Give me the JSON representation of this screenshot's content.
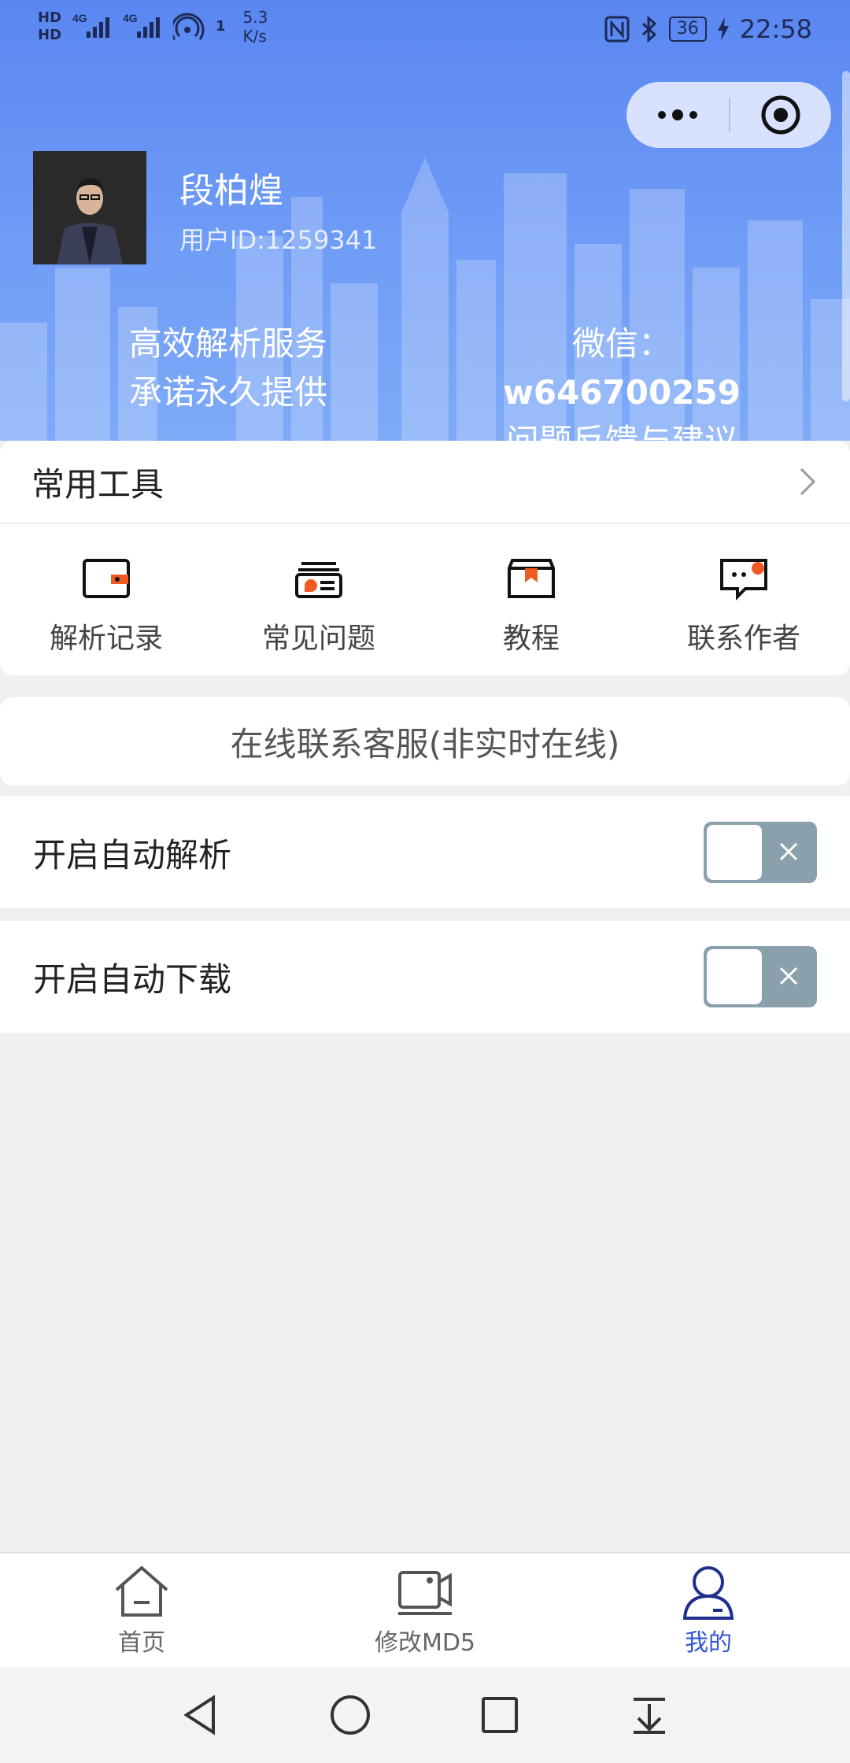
{
  "status_bar": {
    "hd1": "HD",
    "hd2": "HD",
    "net1": "4G",
    "net2": "4G",
    "wifi_count": "1",
    "speed": "5.3",
    "speed_unit": "K/s",
    "battery": "36",
    "time": "22:58"
  },
  "capsule": {
    "more_icon": "more-dots-icon",
    "close_icon": "target-close-icon"
  },
  "user": {
    "name": "段柏煌",
    "id_text": "用户ID:1259341"
  },
  "promo": {
    "left_line1": "高效解析服务",
    "left_line2": "承诺永久提供",
    "right_line1_prefix": "微信：",
    "right_line1_value": "w646700259",
    "right_line2": "问题反馈与建议"
  },
  "tools": {
    "title": "常用工具",
    "items": [
      {
        "label": "解析记录",
        "icon": "wallet-icon"
      },
      {
        "label": "常见问题",
        "icon": "card-stack-icon"
      },
      {
        "label": "教程",
        "icon": "bookmark-box-icon"
      },
      {
        "label": "联系作者",
        "icon": "chat-bubble-icon"
      }
    ]
  },
  "service": {
    "label": "在线联系客服(非实时在线)"
  },
  "settings": {
    "auto_parse": {
      "label": "开启自动解析",
      "enabled": false
    },
    "auto_download": {
      "label": "开启自动下载",
      "enabled": false
    }
  },
  "tabbar": {
    "tabs": [
      {
        "label": "首页",
        "icon": "home-icon",
        "active": false
      },
      {
        "label": "修改MD5",
        "icon": "video-edit-icon",
        "active": false
      },
      {
        "label": "我的",
        "icon": "user-icon",
        "active": true
      }
    ]
  },
  "colors": {
    "accent": "#3256d6",
    "header_top": "#5a86f2",
    "header_bottom": "#7eaaf8",
    "tool_orange": "#f05a22"
  }
}
